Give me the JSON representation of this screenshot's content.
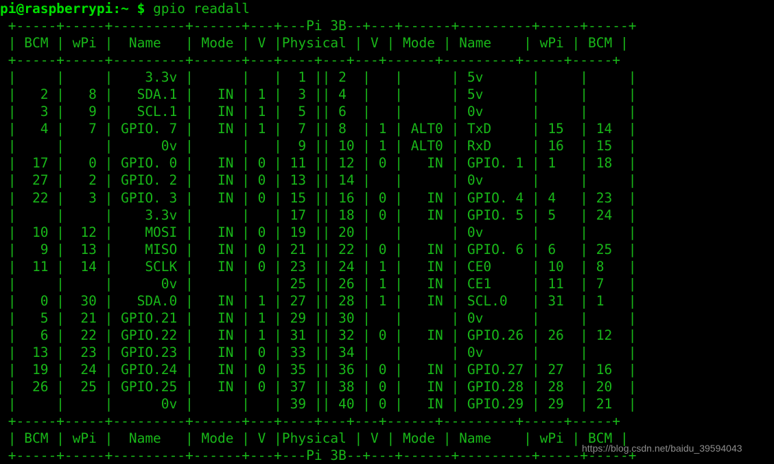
{
  "terminal": {
    "title": "gpio readall",
    "background_color": "#000000",
    "foreground_color": "#19b719",
    "prompt_color": "#00e000",
    "watermark_color": "#9a9a9a"
  },
  "prompt": {
    "user_host": "pi@raspberrypi:~ $",
    "command": " gpio readall"
  },
  "table": {
    "board_label": "Pi 3B",
    "rule": " +-----+-----+---------+------+---+---+---+---+------+---------+-----+-----+",
    "rule_top": " +-----+-----+---------+------+---+---Pi 3B--+---+------+---------+-----+-----+",
    "rule_bottom": " +-----+-----+---------+------+---+---Pi 3B--+---+------+---------+-----+-----+",
    "header_labels": [
      "BCM",
      "wPi",
      "Name",
      "Mode",
      "V",
      "Physical",
      "V",
      "Mode",
      "Name",
      "wPi",
      "BCM"
    ],
    "header_line": " | BCM | wPi |   Name  | Mode | V | Physical | V | Mode | Name    | wPi | BCM |",
    "columns": [
      "BCM",
      "wPi",
      "Name",
      "Mode",
      "V",
      "Physical",
      "V",
      "Mode",
      "Name",
      "wPi",
      "BCM"
    ],
    "rows": [
      {
        "bcm_l": "",
        "wpi_l": "",
        "name_l": "3.3v",
        "mode_l": "",
        "v_l": "",
        "phys_l": "1",
        "phys_r": "2",
        "v_r": "",
        "mode_r": "",
        "name_r": "5v",
        "wpi_r": "",
        "bcm_r": ""
      },
      {
        "bcm_l": "2",
        "wpi_l": "8",
        "name_l": "SDA.1",
        "mode_l": "IN",
        "v_l": "1",
        "phys_l": "3",
        "phys_r": "4",
        "v_r": "",
        "mode_r": "",
        "name_r": "5v",
        "wpi_r": "",
        "bcm_r": ""
      },
      {
        "bcm_l": "3",
        "wpi_l": "9",
        "name_l": "SCL.1",
        "mode_l": "IN",
        "v_l": "1",
        "phys_l": "5",
        "phys_r": "6",
        "v_r": "",
        "mode_r": "",
        "name_r": "0v",
        "wpi_r": "",
        "bcm_r": ""
      },
      {
        "bcm_l": "4",
        "wpi_l": "7",
        "name_l": "GPIO. 7",
        "mode_l": "IN",
        "v_l": "1",
        "phys_l": "7",
        "phys_r": "8",
        "v_r": "1",
        "mode_r": "ALT0",
        "name_r": "TxD",
        "wpi_r": "15",
        "bcm_r": "14"
      },
      {
        "bcm_l": "",
        "wpi_l": "",
        "name_l": "0v",
        "mode_l": "",
        "v_l": "",
        "phys_l": "9",
        "phys_r": "10",
        "v_r": "1",
        "mode_r": "ALT0",
        "name_r": "RxD",
        "wpi_r": "16",
        "bcm_r": "15"
      },
      {
        "bcm_l": "17",
        "wpi_l": "0",
        "name_l": "GPIO. 0",
        "mode_l": "IN",
        "v_l": "0",
        "phys_l": "11",
        "phys_r": "12",
        "v_r": "0",
        "mode_r": "IN",
        "name_r": "GPIO. 1",
        "wpi_r": "1",
        "bcm_r": "18"
      },
      {
        "bcm_l": "27",
        "wpi_l": "2",
        "name_l": "GPIO. 2",
        "mode_l": "IN",
        "v_l": "0",
        "phys_l": "13",
        "phys_r": "14",
        "v_r": "",
        "mode_r": "",
        "name_r": "0v",
        "wpi_r": "",
        "bcm_r": ""
      },
      {
        "bcm_l": "22",
        "wpi_l": "3",
        "name_l": "GPIO. 3",
        "mode_l": "IN",
        "v_l": "0",
        "phys_l": "15",
        "phys_r": "16",
        "v_r": "0",
        "mode_r": "IN",
        "name_r": "GPIO. 4",
        "wpi_r": "4",
        "bcm_r": "23"
      },
      {
        "bcm_l": "",
        "wpi_l": "",
        "name_l": "3.3v",
        "mode_l": "",
        "v_l": "",
        "phys_l": "17",
        "phys_r": "18",
        "v_r": "0",
        "mode_r": "IN",
        "name_r": "GPIO. 5",
        "wpi_r": "5",
        "bcm_r": "24"
      },
      {
        "bcm_l": "10",
        "wpi_l": "12",
        "name_l": "MOSI",
        "mode_l": "IN",
        "v_l": "0",
        "phys_l": "19",
        "phys_r": "20",
        "v_r": "",
        "mode_r": "",
        "name_r": "0v",
        "wpi_r": "",
        "bcm_r": ""
      },
      {
        "bcm_l": "9",
        "wpi_l": "13",
        "name_l": "MISO",
        "mode_l": "IN",
        "v_l": "0",
        "phys_l": "21",
        "phys_r": "22",
        "v_r": "0",
        "mode_r": "IN",
        "name_r": "GPIO. 6",
        "wpi_r": "6",
        "bcm_r": "25"
      },
      {
        "bcm_l": "11",
        "wpi_l": "14",
        "name_l": "SCLK",
        "mode_l": "IN",
        "v_l": "0",
        "phys_l": "23",
        "phys_r": "24",
        "v_r": "1",
        "mode_r": "IN",
        "name_r": "CE0",
        "wpi_r": "10",
        "bcm_r": "8"
      },
      {
        "bcm_l": "",
        "wpi_l": "",
        "name_l": "0v",
        "mode_l": "",
        "v_l": "",
        "phys_l": "25",
        "phys_r": "26",
        "v_r": "1",
        "mode_r": "IN",
        "name_r": "CE1",
        "wpi_r": "11",
        "bcm_r": "7"
      },
      {
        "bcm_l": "0",
        "wpi_l": "30",
        "name_l": "SDA.0",
        "mode_l": "IN",
        "v_l": "1",
        "phys_l": "27",
        "phys_r": "28",
        "v_r": "1",
        "mode_r": "IN",
        "name_r": "SCL.0",
        "wpi_r": "31",
        "bcm_r": "1"
      },
      {
        "bcm_l": "5",
        "wpi_l": "21",
        "name_l": "GPIO.21",
        "mode_l": "IN",
        "v_l": "1",
        "phys_l": "29",
        "phys_r": "30",
        "v_r": "",
        "mode_r": "",
        "name_r": "0v",
        "wpi_r": "",
        "bcm_r": ""
      },
      {
        "bcm_l": "6",
        "wpi_l": "22",
        "name_l": "GPIO.22",
        "mode_l": "IN",
        "v_l": "1",
        "phys_l": "31",
        "phys_r": "32",
        "v_r": "0",
        "mode_r": "IN",
        "name_r": "GPIO.26",
        "wpi_r": "26",
        "bcm_r": "12"
      },
      {
        "bcm_l": "13",
        "wpi_l": "23",
        "name_l": "GPIO.23",
        "mode_l": "IN",
        "v_l": "0",
        "phys_l": "33",
        "phys_r": "34",
        "v_r": "",
        "mode_r": "",
        "name_r": "0v",
        "wpi_r": "",
        "bcm_r": ""
      },
      {
        "bcm_l": "19",
        "wpi_l": "24",
        "name_l": "GPIO.24",
        "mode_l": "IN",
        "v_l": "0",
        "phys_l": "35",
        "phys_r": "36",
        "v_r": "0",
        "mode_r": "IN",
        "name_r": "GPIO.27",
        "wpi_r": "27",
        "bcm_r": "16"
      },
      {
        "bcm_l": "26",
        "wpi_l": "25",
        "name_l": "GPIO.25",
        "mode_l": "IN",
        "v_l": "0",
        "phys_l": "37",
        "phys_r": "38",
        "v_r": "0",
        "mode_r": "IN",
        "name_r": "GPIO.28",
        "wpi_r": "28",
        "bcm_r": "20"
      },
      {
        "bcm_l": "",
        "wpi_l": "",
        "name_l": "0v",
        "mode_l": "",
        "v_l": "",
        "phys_l": "39",
        "phys_r": "40",
        "v_r": "0",
        "mode_r": "IN",
        "name_r": "GPIO.29",
        "wpi_r": "29",
        "bcm_r": "21"
      }
    ]
  },
  "watermark": {
    "text": "https://blog.csdn.net/baidu_39594043"
  }
}
